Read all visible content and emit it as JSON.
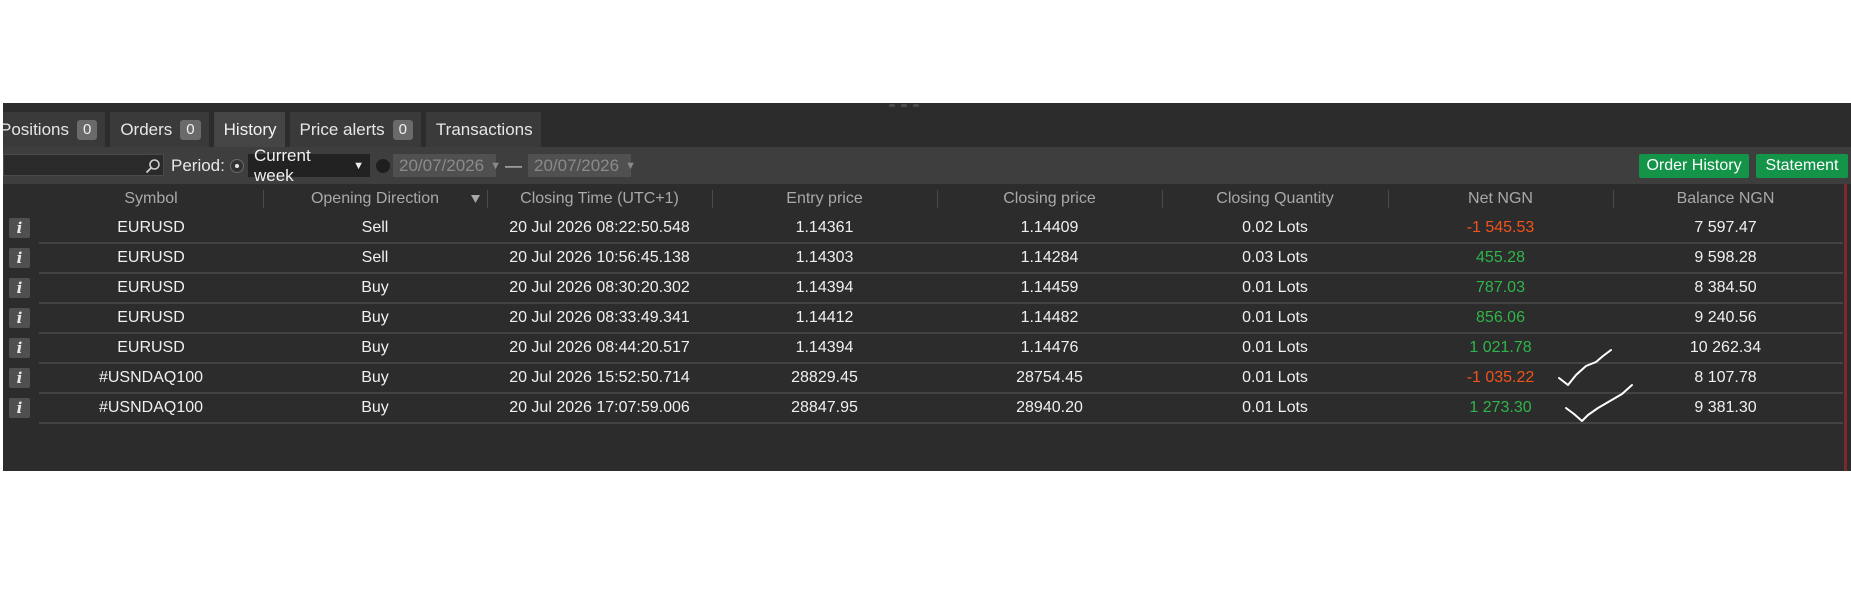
{
  "tabs": [
    {
      "label": "Positions",
      "count": "0"
    },
    {
      "label": "Orders",
      "count": "0"
    },
    {
      "label": "History"
    },
    {
      "label": "Price alerts",
      "count": "0"
    },
    {
      "label": "Transactions"
    }
  ],
  "active_tab": "History",
  "filter": {
    "search_value": "",
    "period_label": "Period:",
    "period_value": "Current week",
    "date_from": "20/07/2026",
    "date_separator": "—",
    "date_to": "20/07/2026",
    "order_history_label": "Order History",
    "statement_label": "Statement"
  },
  "columns": [
    "Symbol",
    "Opening Direction",
    "Closing Time (UTC+1)",
    "Entry price",
    "Closing price",
    "Closing Quantity",
    "Net NGN",
    "Balance NGN"
  ],
  "rows": [
    {
      "info": "i",
      "symbol": "EURUSD",
      "direction": "Sell",
      "closing_time": "20 Jul 2026 08:22:50.548",
      "entry": "1.14361",
      "closing": "1.14409",
      "quantity": "0.02 Lots",
      "net": "-1 545.53",
      "balance": "7 597.47"
    },
    {
      "info": "i",
      "symbol": "EURUSD",
      "direction": "Sell",
      "closing_time": "20 Jul 2026 10:56:45.138",
      "entry": "1.14303",
      "closing": "1.14284",
      "quantity": "0.03 Lots",
      "net": "455.28",
      "balance": "9 598.28"
    },
    {
      "info": "i",
      "symbol": "EURUSD",
      "direction": "Buy",
      "closing_time": "20 Jul 2026 08:30:20.302",
      "entry": "1.14394",
      "closing": "1.14459",
      "quantity": "0.01 Lots",
      "net": "787.03",
      "balance": "8 384.50"
    },
    {
      "info": "i",
      "symbol": "EURUSD",
      "direction": "Buy",
      "closing_time": "20 Jul 2026 08:33:49.341",
      "entry": "1.14412",
      "closing": "1.14482",
      "quantity": "0.01 Lots",
      "net": "856.06",
      "balance": "9 240.56"
    },
    {
      "info": "i",
      "symbol": "EURUSD",
      "direction": "Buy",
      "closing_time": "20 Jul 2026 08:44:20.517",
      "entry": "1.14394",
      "closing": "1.14476",
      "quantity": "0.01 Lots",
      "net": "1 021.78",
      "balance": "10 262.34"
    },
    {
      "info": "i",
      "symbol": "#USNDAQ100",
      "direction": "Buy",
      "closing_time": "20 Jul 2026 15:52:50.714",
      "entry": "28829.45",
      "closing": "28754.45",
      "quantity": "0.01 Lots",
      "net": "-1 035.22",
      "balance": "8 107.78"
    },
    {
      "info": "i",
      "symbol": "#USNDAQ100",
      "direction": "Buy",
      "closing_time": "20 Jul 2026 17:07:59.006",
      "entry": "28847.95",
      "closing": "28940.20",
      "quantity": "0.01 Lots",
      "net": "1 273.30",
      "balance": "9 381.30"
    }
  ],
  "colors": {
    "negative": "#f2531c",
    "positive": "#2fb54a",
    "button_green": "#139448"
  }
}
